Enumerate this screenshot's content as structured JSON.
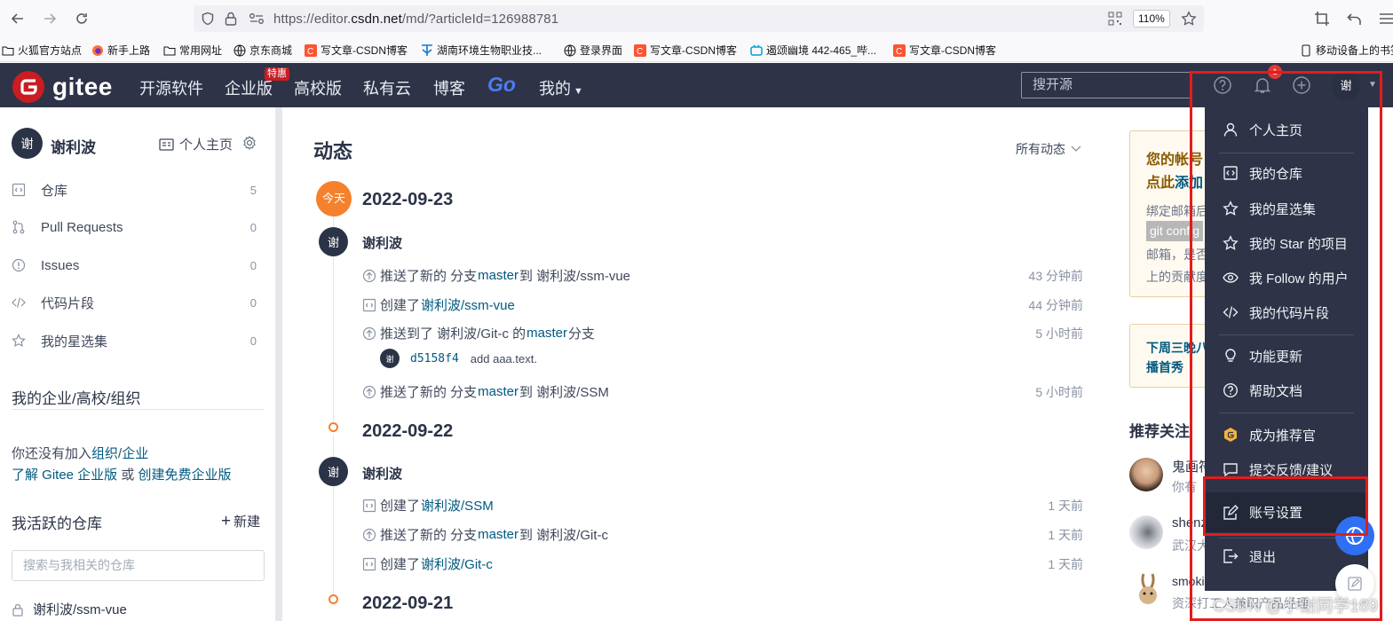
{
  "browser": {
    "url_prefix": "https://editor.",
    "url_domain": "csdn.net",
    "url_path": "/md/?articleId=126988781",
    "zoom": "110%",
    "bookmarks": [
      {
        "label": "火狐官方站点"
      },
      {
        "label": "新手上路"
      },
      {
        "label": "常用网址"
      },
      {
        "label": "京东商城"
      },
      {
        "label": "写文章-CSDN博客"
      },
      {
        "label": "湖南环境生物职业技..."
      },
      {
        "label": "登录界面"
      },
      {
        "label": "写文章-CSDN博客"
      },
      {
        "label": "遏颂幽境 442-465_哔..."
      },
      {
        "label": "写文章-CSDN博客"
      }
    ],
    "mobile_bookmarks": "移动设备上的书签"
  },
  "header": {
    "logo": "gitee",
    "nav": [
      "开源软件",
      "企业版",
      "高校版",
      "私有云",
      "博客",
      "Go",
      "我的"
    ],
    "sale_badge": "特惠",
    "search_placeholder": "搜开源",
    "notification_count": "1",
    "avatar": "谢"
  },
  "sidebar": {
    "user_avatar": "谢",
    "user_name": "谢利波",
    "home_link": "个人主页",
    "items": [
      {
        "label": "仓库",
        "count": "5"
      },
      {
        "label": "Pull Requests",
        "count": "0"
      },
      {
        "label": "Issues",
        "count": "0"
      },
      {
        "label": "代码片段",
        "count": "0"
      },
      {
        "label": "我的星选集",
        "count": "0"
      }
    ],
    "org_title": "我的企业/高校/组织",
    "org_text1": "你还没有加入",
    "org_link1": "组织",
    "org_sep": "/",
    "org_link2": "企业",
    "org_link3": "了解 Gitee 企业版",
    "org_or": " 或 ",
    "org_link4": "创建免费企业版",
    "active_title": "我活跃的仓库",
    "new_label": "新建",
    "repo_search_placeholder": "搜索与我相关的仓库",
    "repo_first": "谢利波/ssm-vue"
  },
  "main": {
    "title": "动态",
    "filter": "所有动态",
    "today_badge": "今天",
    "groups": [
      {
        "date": "2022-09-23",
        "user": "谢利波",
        "avatar": "谢",
        "activities": [
          {
            "pre": "推送了新的 分支 ",
            "link": "master",
            "mid": " 到 谢利波/ssm-vue",
            "time": "43 分钟前"
          },
          {
            "pre": "创建了 ",
            "link": "谢利波/ssm-vue",
            "mid": "",
            "time": "44 分钟前"
          },
          {
            "pre": "推送到了 谢利波/Git-c 的 ",
            "link": "master",
            "mid": " 分支",
            "time": "5 小时前"
          },
          {
            "pre": "推送了新的 分支 ",
            "link": "master",
            "mid": " 到 谢利波/SSM",
            "time": "5 小时前"
          }
        ],
        "commit": {
          "hash": "d5158f4",
          "msg": "add aaa.text."
        }
      },
      {
        "date": "2022-09-22",
        "user": "谢利波",
        "avatar": "谢",
        "activities": [
          {
            "pre": "创建了 ",
            "link": "谢利波/SSM",
            "mid": "",
            "time": "1 天前"
          },
          {
            "pre": "推送了新的 分支 ",
            "link": "master",
            "mid": " 到 谢利波/Git-c",
            "time": "1 天前"
          },
          {
            "pre": "创建了 ",
            "link": "谢利波/Git-c",
            "mid": "",
            "time": "1 天前"
          }
        ]
      },
      {
        "date": "2022-09-21"
      }
    ]
  },
  "right": {
    "notice1_line1": "您的帐号",
    "notice1_line2a": "点此",
    "notice1_line2b": "添加",
    "notice1_body1": "绑定邮箱后",
    "notice1_code": "git config",
    "notice1_body2": "邮箱，是否",
    "notice1_body3": "上的贡献度",
    "notice2_line1": "下周三晚八",
    "notice2_line2": "播首秀",
    "recommend_title": "推荐关注",
    "users": [
      {
        "name": "鬼画符",
        "desc": "你有"
      },
      {
        "name": "shenz",
        "desc": "武汉大"
      },
      {
        "name": "smokingRabbit",
        "desc": "资深打工人兼职产品经理"
      }
    ]
  },
  "dropdown": {
    "items": [
      {
        "label": "个人主页"
      },
      {
        "label": "我的仓库"
      },
      {
        "label": "我的星选集"
      },
      {
        "label": "我的 Star 的项目"
      },
      {
        "label": "我 Follow 的用户"
      },
      {
        "label": "我的代码片段"
      },
      {
        "label": "功能更新"
      },
      {
        "label": "帮助文档"
      },
      {
        "label": "成为推荐官"
      },
      {
        "label": "提交反馈/建议"
      },
      {
        "label": "账号设置"
      },
      {
        "label": "退出"
      }
    ]
  },
  "watermark": "CSDN @小谢同学189"
}
